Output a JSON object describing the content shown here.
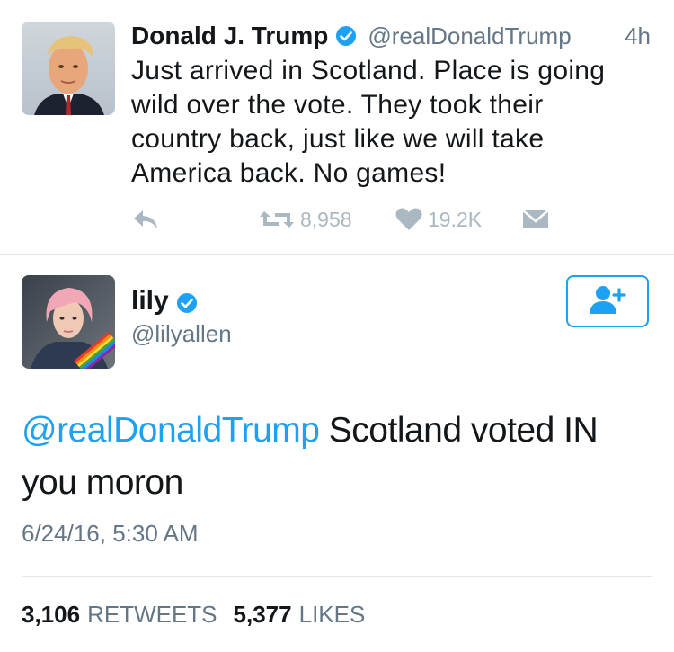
{
  "colors": {
    "brand": "#1da1f2",
    "muted": "#657786",
    "icon": "#aab8c2",
    "text": "#14171a"
  },
  "tweet1": {
    "author_name": "Donald J. Trump",
    "handle": "@realDonaldTrump",
    "time": "4h",
    "text": "Just arrived in Scotland. Place is going wild over the vote. They took their country back, just like we will take America back. No games!",
    "actions": {
      "reply_icon": "reply-icon",
      "retweet_icon": "retweet-icon",
      "retweet_count": "8,958",
      "like_icon": "heart-icon",
      "like_count": "19.2K",
      "dm_icon": "envelope-icon"
    }
  },
  "tweet2": {
    "author_name": "lily",
    "handle": "@lilyallen",
    "follow_icon": "add-user-icon",
    "mention": "@realDonaldTrump",
    "text": " Scotland voted IN you moron",
    "date": "6/24/16, 5:30 AM",
    "stats": {
      "retweets_count": "3,106",
      "retweets_label": "RETWEETS",
      "likes_count": "5,377",
      "likes_label": "LIKES"
    }
  }
}
